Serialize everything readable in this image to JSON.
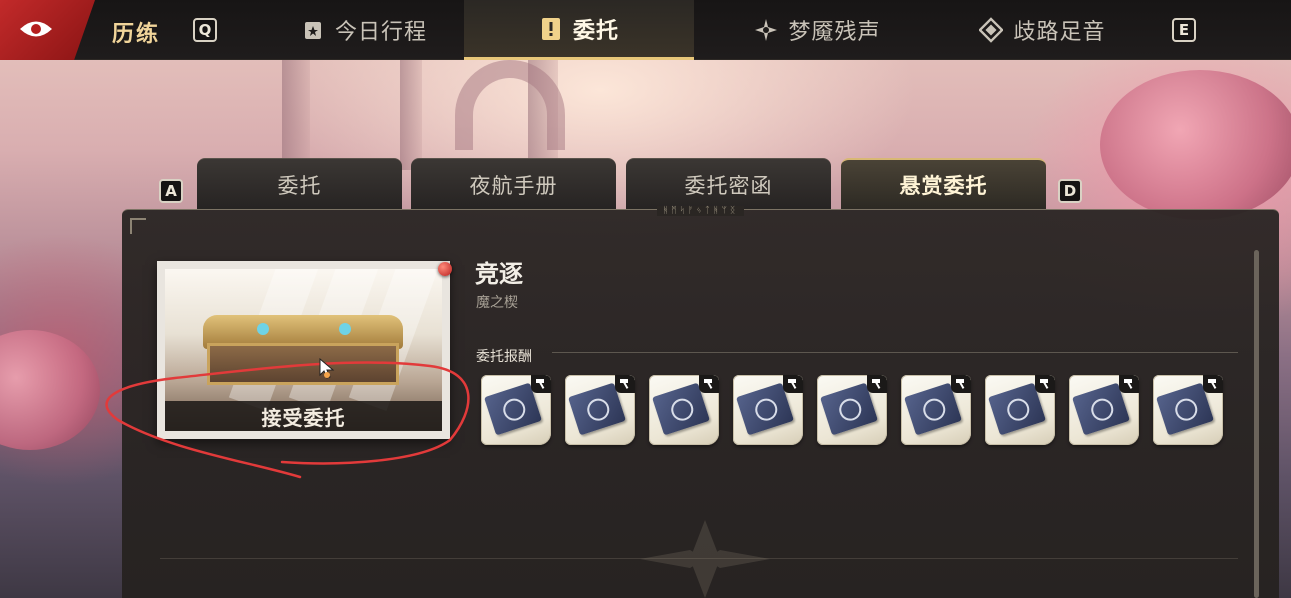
{
  "header": {
    "section_title": "历练",
    "key_left": "Q",
    "key_right": "E",
    "tabs": [
      {
        "label": "今日行程",
        "icon": "schedule-icon",
        "active": false
      },
      {
        "label": "委托",
        "icon": "exclamation-icon",
        "active": true
      },
      {
        "label": "梦魇残声",
        "icon": "nightmare-icon",
        "active": false
      },
      {
        "label": "歧路足音",
        "icon": "crossroads-icon",
        "active": false
      }
    ]
  },
  "subtabs": {
    "key_left": "A",
    "key_right": "D",
    "items": [
      {
        "label": "委托",
        "active": false
      },
      {
        "label": "夜航手册",
        "active": false
      },
      {
        "label": "委托密函",
        "active": false
      },
      {
        "label": "悬赏委托",
        "active": true
      }
    ]
  },
  "panel": {
    "runes": "ᚻᛗᛋᚠᛃᛏᚻᛘᛝ"
  },
  "card": {
    "accept_label": "接受委托"
  },
  "detail": {
    "title": "竞逐",
    "subtitle": "魔之楔",
    "reward_label": "委托报酬",
    "rewards": [
      {
        "icon": "manual-book-icon",
        "badge_icon": "hammer-icon"
      },
      {
        "icon": "manual-book-icon",
        "badge_icon": "hammer-icon"
      },
      {
        "icon": "manual-book-icon",
        "badge_icon": "hammer-icon"
      },
      {
        "icon": "manual-book-icon",
        "badge_icon": "hammer-icon"
      },
      {
        "icon": "manual-book-icon",
        "badge_icon": "hammer-icon"
      },
      {
        "icon": "manual-book-icon",
        "badge_icon": "hammer-icon"
      },
      {
        "icon": "manual-book-icon",
        "badge_icon": "hammer-icon"
      },
      {
        "icon": "manual-book-icon",
        "badge_icon": "hammer-icon"
      },
      {
        "icon": "manual-book-icon",
        "badge_icon": "hammer-icon"
      }
    ]
  },
  "colors": {
    "accent_gold": "#e8c77a",
    "logo_red": "#c22a2a",
    "annotation_red": "#e23a3a"
  }
}
